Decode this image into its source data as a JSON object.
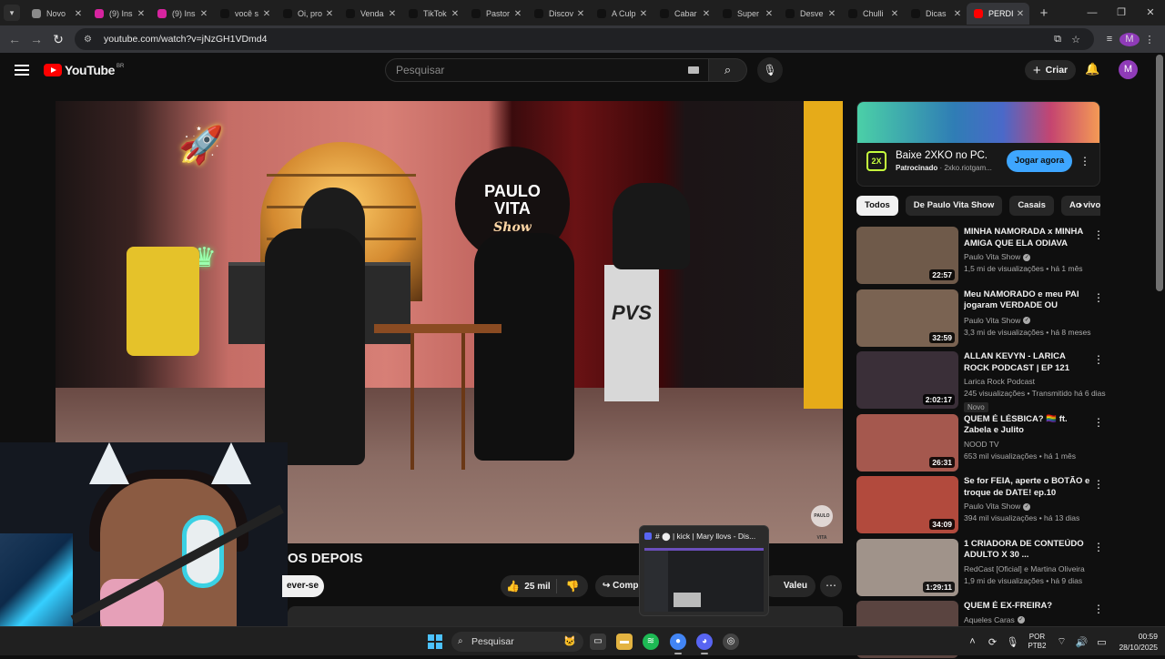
{
  "browser": {
    "tabs": [
      {
        "label": "Novo",
        "icon": "chrome-icon",
        "color": "#8a8a8a"
      },
      {
        "label": "(9) Ins",
        "icon": "instagram-icon",
        "color": "#d6249f"
      },
      {
        "label": "(9) Ins",
        "icon": "instagram-icon",
        "color": "#d6249f"
      },
      {
        "label": "você s",
        "icon": "tiktok-icon",
        "color": "#111111"
      },
      {
        "label": "Oi, pro",
        "icon": "tiktok-icon",
        "color": "#111111"
      },
      {
        "label": "Venda",
        "icon": "tiktok-icon",
        "color": "#111111"
      },
      {
        "label": "TikTok",
        "icon": "tiktok-icon",
        "color": "#111111"
      },
      {
        "label": "Pastor",
        "icon": "tiktok-icon",
        "color": "#111111"
      },
      {
        "label": "Discov",
        "icon": "tiktok-icon",
        "color": "#111111"
      },
      {
        "label": "A Culp",
        "icon": "tiktok-icon",
        "color": "#111111"
      },
      {
        "label": "Cabar",
        "icon": "tiktok-icon",
        "color": "#111111"
      },
      {
        "label": "Super",
        "icon": "tiktok-icon",
        "color": "#111111"
      },
      {
        "label": "Desve",
        "icon": "tiktok-icon",
        "color": "#111111"
      },
      {
        "label": "Chulli",
        "icon": "tiktok-icon",
        "color": "#111111"
      },
      {
        "label": "Dicas",
        "icon": "tiktok-icon",
        "color": "#111111"
      },
      {
        "label": "PERDI",
        "icon": "youtube-icon",
        "color": "#ff0000",
        "active": true
      }
    ],
    "url": "youtube.com/watch?v=jNzGH1VDmd4",
    "profile_initial": "M"
  },
  "youtube": {
    "brand": "YouTube",
    "country": "BR",
    "search_placeholder": "Pesquisar",
    "create_label": "Criar",
    "avatar_initial": "M"
  },
  "video": {
    "logo_line1": "PAULO",
    "logo_line2": "VITA",
    "logo_script": "Show",
    "set_text": "PVS",
    "watermark": "PAULO VITA",
    "title_visible": "OS DEPOIS",
    "subscribe_label": "ever-se",
    "likes": "25 mil",
    "share_label": "Comp",
    "thanks_label": "Valeu"
  },
  "taskbar_popup": {
    "title": "# ⬤ | kick | Mary llovs - Dis..."
  },
  "ad": {
    "title": "Baixe 2XKO no PC.",
    "sponsored": "Patrocinado",
    "domain": "2xko.riotgam...",
    "cta": "Jogar agora",
    "logo_text": "2X"
  },
  "chips": [
    "Todos",
    "De Paulo Vita Show",
    "Casais",
    "Ao vivo"
  ],
  "recommendations": [
    {
      "title": "MINHA NAMORADA x MINHA AMIGA QUE ELA ODIAVA",
      "channel": "Paulo Vita Show",
      "verified": true,
      "views": "1,5 mi de visualizações",
      "age": "há 1 mês",
      "duration": "22:57",
      "thumb": "#6f5a4a"
    },
    {
      "title": "Meu NAMORADO e meu PAI jogaram VERDADE OU DESAFIO",
      "channel": "Paulo Vita Show",
      "verified": true,
      "views": "3,3 mi de visualizações",
      "age": "há 8 meses",
      "duration": "32:59",
      "thumb": "#7a6352"
    },
    {
      "title": "ALLAN KEVYN - LARICA ROCK PODCAST | EP 121",
      "channel": "Larica Rock Podcast",
      "verified": false,
      "views": "245 visualizações",
      "age": "Transmitido há 6 dias",
      "duration": "2:02:17",
      "badge": "Novo",
      "thumb": "#3a2f38"
    },
    {
      "title": "QUEM É LÉSBICA? 🏳️‍🌈 ft. Zabela e Julito",
      "channel": "NOOD TV",
      "verified": false,
      "views": "653 mil visualizações",
      "age": "há 1 mês",
      "duration": "26:31",
      "thumb": "#a5584e"
    },
    {
      "title": "Se for FEIA, aperte o BOTÃO e troque de DATE! ep.10",
      "channel": "Paulo Vita Show",
      "verified": true,
      "views": "394 mil visualizações",
      "age": "há 13 dias",
      "duration": "34:09",
      "thumb": "#b24a3d"
    },
    {
      "title": "1 CRIADORA DE CONTEÚDO ADULTO X 30 ...",
      "channel": "RedCast [Oficial] e Martina Oliveira",
      "verified": false,
      "views": "1,9 mi de visualizações",
      "age": "há 9 dias",
      "duration": "1:29:11",
      "thumb": "#a0938a"
    },
    {
      "title": "QUEM É EX-FREIRA?",
      "channel": "Aqueles Caras",
      "verified": true,
      "views": "",
      "age": "",
      "duration": "",
      "thumb": "#5a4440"
    }
  ],
  "taskbar": {
    "search_label": "Pesquisar",
    "lang_line1": "POR",
    "lang_line2": "PTB2",
    "time": "00:59",
    "date": "28/10/2025"
  }
}
